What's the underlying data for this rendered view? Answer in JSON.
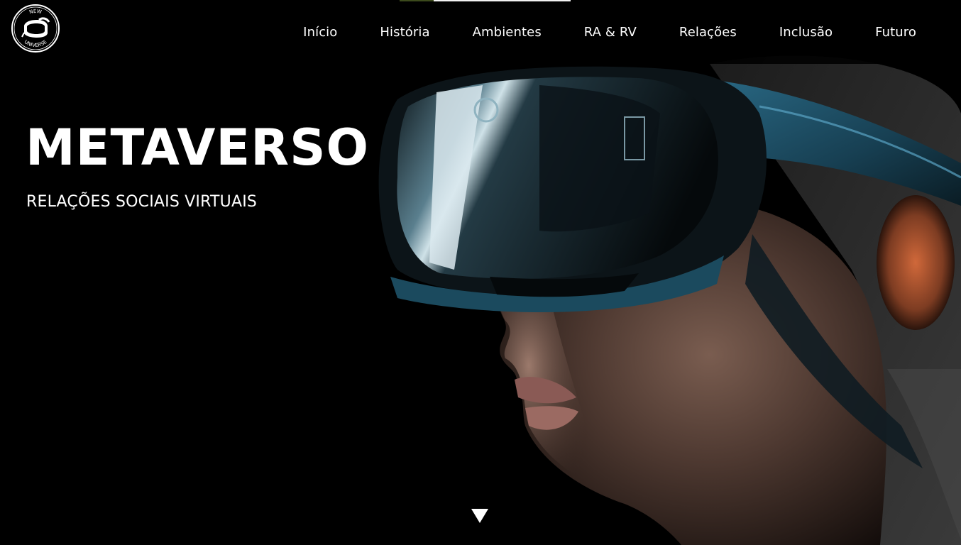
{
  "header": {
    "logo": {
      "top_text": "NEW",
      "bottom_text": "UNIVERSE",
      "icon": "vr-headset-icon"
    },
    "progress": 0.2,
    "nav": [
      {
        "label": "Início"
      },
      {
        "label": "História"
      },
      {
        "label": "Ambientes"
      },
      {
        "label": "RA & RV"
      },
      {
        "label": "Relações"
      },
      {
        "label": "Inclusão"
      },
      {
        "label": "Futuro"
      }
    ]
  },
  "hero": {
    "title": "METAVERSO",
    "subtitle": "RELAÇÕES SOCIAIS VIRTUAIS",
    "image": "woman-wearing-vr-headset-photo",
    "scroll_icon": "triangle-down-icon"
  },
  "colors": {
    "background": "#000000",
    "text": "#ffffff",
    "progress_track": "#f2f2f2",
    "progress_fill": "#3c4a1c",
    "headset_accent": "#2f6f8c"
  }
}
